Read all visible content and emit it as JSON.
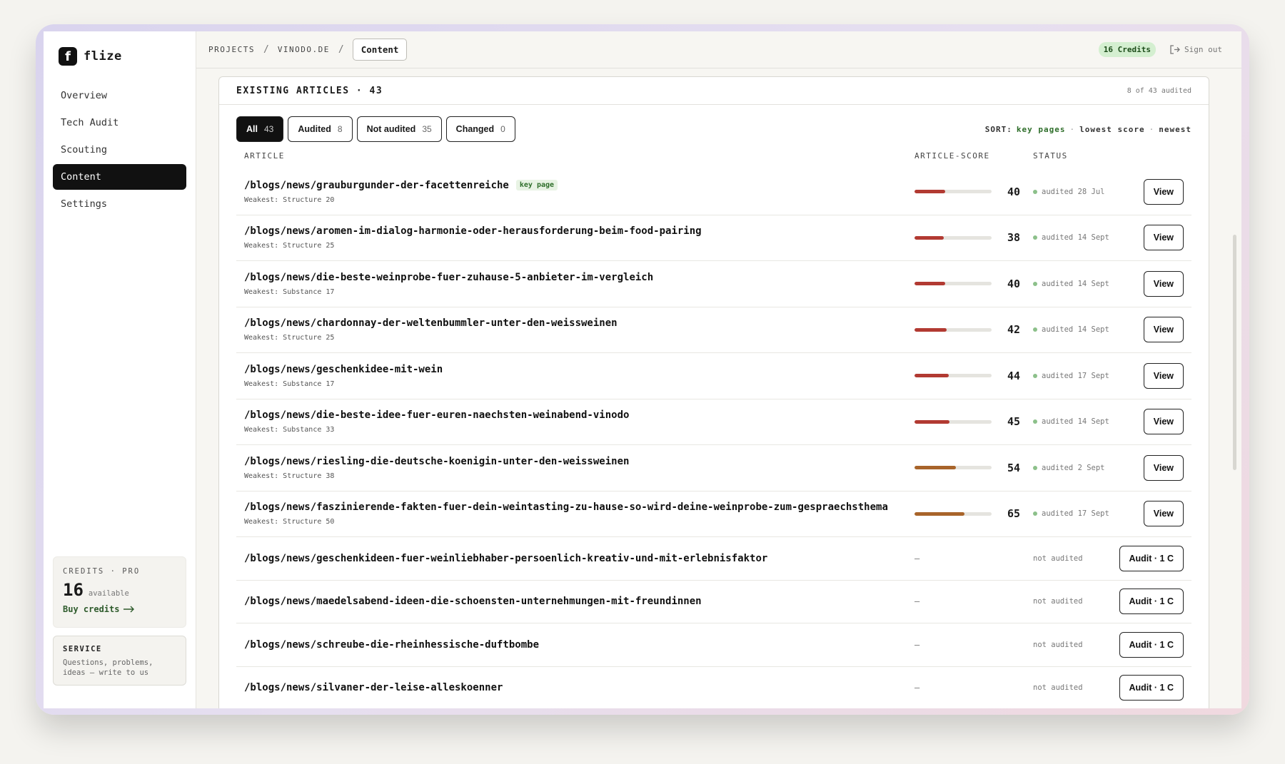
{
  "brand": {
    "name": "flize",
    "logo_letter": "f"
  },
  "sidebar": {
    "items": [
      {
        "label": "Overview",
        "active": false
      },
      {
        "label": "Tech Audit",
        "active": false
      },
      {
        "label": "Scouting",
        "active": false
      },
      {
        "label": "Content",
        "active": true
      },
      {
        "label": "Settings",
        "active": false
      }
    ],
    "credits": {
      "label": "CREDITS · PRO",
      "value": "16",
      "available": "available",
      "buy": "Buy credits"
    },
    "service": {
      "label": "SERVICE",
      "text": "Questions, problems, ideas — write to us"
    }
  },
  "topbar": {
    "crumbs": [
      "PROJECTS",
      "VINODO.DE"
    ],
    "current": "Content",
    "credits_pill": "16 Credits",
    "signout": "Sign out"
  },
  "card": {
    "title": "EXISTING ARTICLES · 43",
    "meta": "8 of 43 audited",
    "filters": [
      {
        "label": "All",
        "count": "43",
        "active": true
      },
      {
        "label": "Audited",
        "count": "8",
        "active": false
      },
      {
        "label": "Not audited",
        "count": "35",
        "active": false
      },
      {
        "label": "Changed",
        "count": "0",
        "active": false
      }
    ],
    "sort": {
      "label": "SORT:",
      "options": [
        {
          "label": "key pages",
          "active": true
        },
        {
          "label": "lowest score",
          "active": false
        },
        {
          "label": "newest",
          "active": false
        }
      ]
    },
    "columns": {
      "article": "ARTICLE",
      "score": "ARTICLE-SCORE",
      "status": "STATUS"
    },
    "rows": [
      {
        "path": "/blogs/news/grauburgunder-der-facettenreiche",
        "key_page": "key page",
        "weakest": "Weakest: Structure 20",
        "score": 40,
        "status": "audited 28 Jul",
        "action": "View",
        "audited": true
      },
      {
        "path": "/blogs/news/aromen-im-dialog-harmonie-oder-herausforderung-beim-food-pairing",
        "weakest": "Weakest: Structure 25",
        "score": 38,
        "status": "audited 14 Sept",
        "action": "View",
        "audited": true
      },
      {
        "path": "/blogs/news/die-beste-weinprobe-fuer-zuhause-5-anbieter-im-vergleich",
        "weakest": "Weakest: Substance 17",
        "score": 40,
        "status": "audited 14 Sept",
        "action": "View",
        "audited": true
      },
      {
        "path": "/blogs/news/chardonnay-der-weltenbummler-unter-den-weissweinen",
        "weakest": "Weakest: Structure 25",
        "score": 42,
        "status": "audited 14 Sept",
        "action": "View",
        "audited": true
      },
      {
        "path": "/blogs/news/geschenkidee-mit-wein",
        "weakest": "Weakest: Substance 17",
        "score": 44,
        "status": "audited 17 Sept",
        "action": "View",
        "audited": true
      },
      {
        "path": "/blogs/news/die-beste-idee-fuer-euren-naechsten-weinabend-vinodo",
        "weakest": "Weakest: Substance 33",
        "score": 45,
        "status": "audited 14 Sept",
        "action": "View",
        "audited": true
      },
      {
        "path": "/blogs/news/riesling-die-deutsche-koenigin-unter-den-weissweinen",
        "weakest": "Weakest: Structure 38",
        "score": 54,
        "status": "audited 2 Sept",
        "action": "View",
        "audited": true
      },
      {
        "path": "/blogs/news/faszinierende-fakten-fuer-dein-weintasting-zu-hause-so-wird-deine-weinprobe-zum-gespraechsthema",
        "weakest": "Weakest: Structure 50",
        "score": 65,
        "status": "audited 17 Sept",
        "action": "View",
        "audited": true
      },
      {
        "path": "/blogs/news/geschenkideen-fuer-weinliebhaber-persoenlich-kreativ-und-mit-erlebnisfaktor",
        "score_text": "–",
        "status": "not audited",
        "action": "Audit · 1 C",
        "audited": false
      },
      {
        "path": "/blogs/news/maedelsabend-ideen-die-schoensten-unternehmungen-mit-freundinnen",
        "score_text": "–",
        "status": "not audited",
        "action": "Audit · 1 C",
        "audited": false
      },
      {
        "path": "/blogs/news/schreube-die-rheinhessische-duftbombe",
        "score_text": "–",
        "status": "not audited",
        "action": "Audit · 1 C",
        "audited": false
      },
      {
        "path": "/blogs/news/silvaner-der-leise-alleskoenner",
        "score_text": "–",
        "status": "not audited",
        "action": "Audit · 1 C",
        "audited": false
      }
    ]
  },
  "colors": {
    "score_low": "#b23a32",
    "score_mid": "#a8642a",
    "status_ok": "#8cc08a",
    "accent_green": "#2e6e2a"
  },
  "icons": {
    "signout": "sign-out-icon",
    "buy": "arrow-right-icon"
  }
}
